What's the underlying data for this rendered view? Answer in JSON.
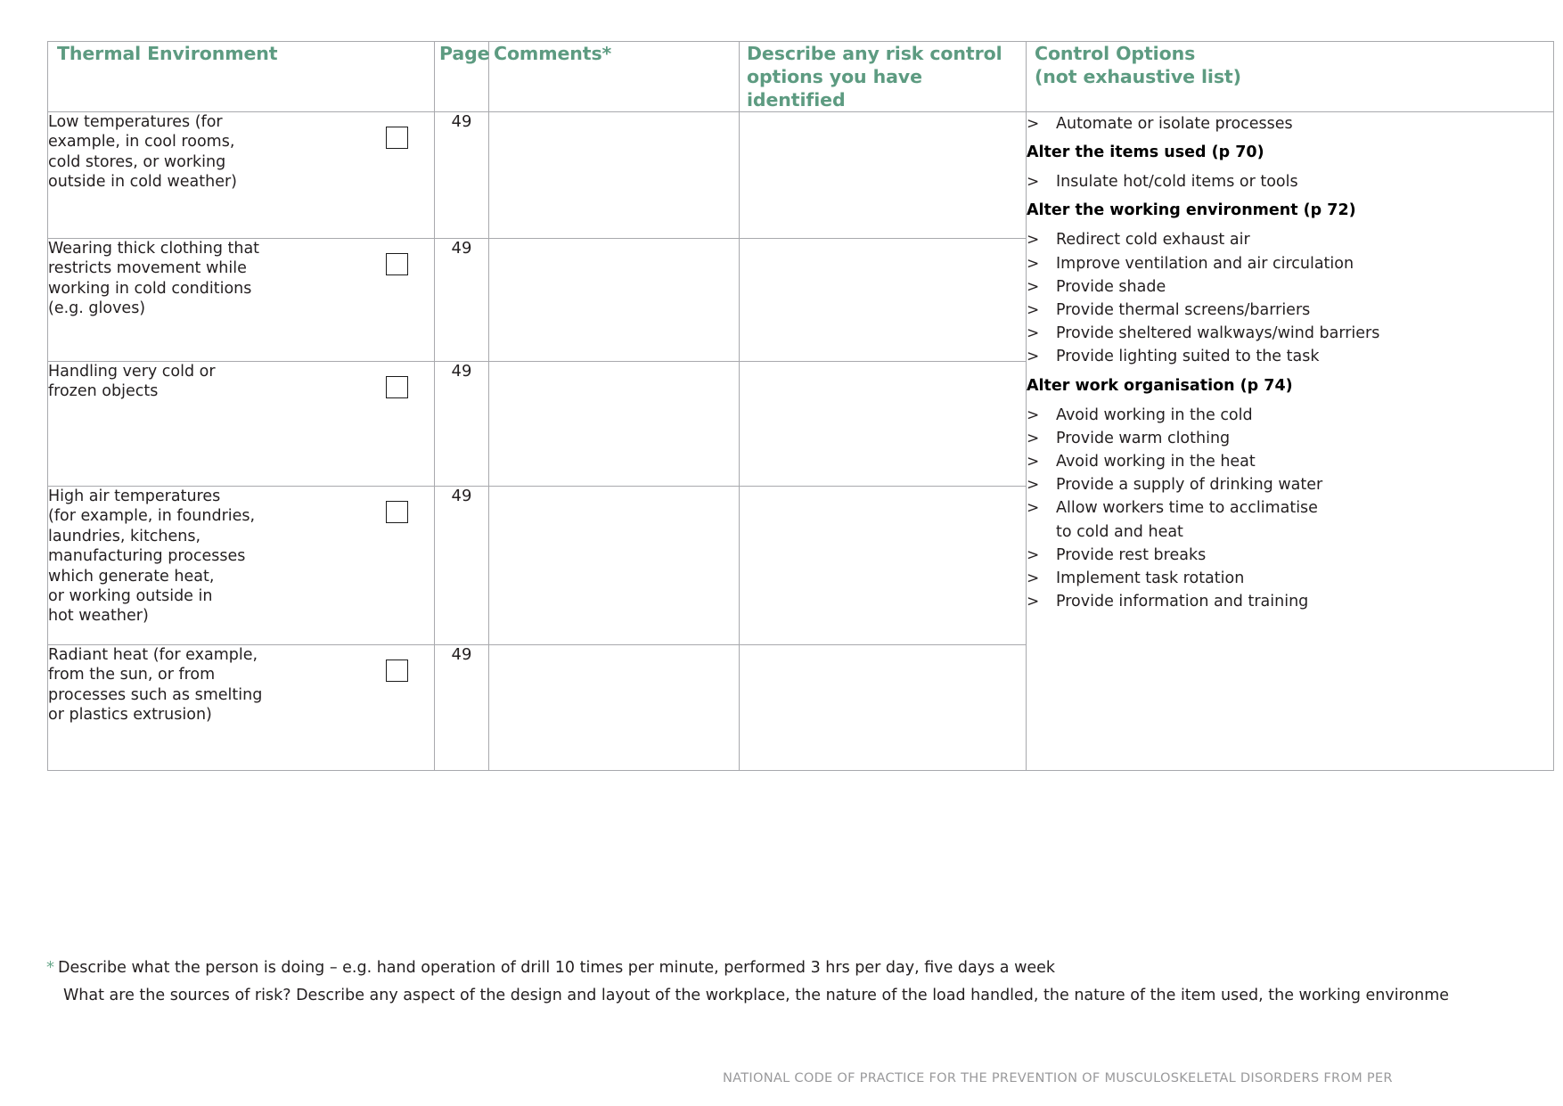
{
  "table": {
    "headers": {
      "hazard": "Thermal Environment",
      "page": "Page",
      "comments": "Comments*",
      "risk_control": "Describe any risk control\noptions you have identified",
      "control_options": "Control Options\n(not exhaustive list)"
    },
    "rows": [
      {
        "hazard": "Low temperatures (for\nexample, in cool rooms,\ncold stores, or working\noutside in cold weather)",
        "page": "49",
        "comments": "",
        "risk_control": ""
      },
      {
        "hazard": "Wearing thick clothing that\nrestricts movement while\nworking in cold conditions\n(e.g. gloves)",
        "page": "49",
        "comments": "",
        "risk_control": ""
      },
      {
        "hazard": "Handling very cold or\nfrozen objects",
        "page": "49",
        "comments": "",
        "risk_control": ""
      },
      {
        "hazard": "High air temperatures\n(for example, in foundries,\nlaundries, kitchens,\nmanufacturing processes\nwhich generate heat,\nor working outside in\nhot weather)",
        "page": "49",
        "comments": "",
        "risk_control": ""
      },
      {
        "hazard": "Radiant heat (for example,\nfrom the sun, or from\nprocesses such as smelting\nor plastics extrusion)",
        "page": "49",
        "comments": "",
        "risk_control": ""
      }
    ],
    "control_options": [
      {
        "kind": "item",
        "text": "Automate or isolate processes"
      },
      {
        "kind": "heading",
        "text": "Alter the items used (p 70)"
      },
      {
        "kind": "item",
        "text": "Insulate hot/cold items or tools"
      },
      {
        "kind": "heading",
        "text": "Alter the working environment (p 72)"
      },
      {
        "kind": "item",
        "text": "Redirect cold exhaust air"
      },
      {
        "kind": "item",
        "text": "Improve ventilation and air circulation"
      },
      {
        "kind": "item",
        "text": "Provide shade"
      },
      {
        "kind": "item",
        "text": "Provide thermal screens/barriers"
      },
      {
        "kind": "item",
        "text": "Provide sheltered walkways/wind barriers"
      },
      {
        "kind": "item",
        "text": "Provide lighting suited to the task"
      },
      {
        "kind": "heading",
        "text": "Alter work organisation (p 74)"
      },
      {
        "kind": "item",
        "text": "Avoid working in the cold"
      },
      {
        "kind": "item",
        "text": "Provide warm clothing"
      },
      {
        "kind": "item",
        "text": "Avoid working in the heat"
      },
      {
        "kind": "item",
        "text": "Provide a supply of drinking water"
      },
      {
        "kind": "item",
        "text": "Allow workers time to acclimatise\nto cold and heat"
      },
      {
        "kind": "item",
        "text": "Provide rest breaks"
      },
      {
        "kind": "item",
        "text": "Implement task rotation"
      },
      {
        "kind": "item",
        "text": "Provide information and training"
      }
    ],
    "bullet_glyph": ">"
  },
  "footnotes": {
    "marker": "*",
    "line1": "Describe what the person is doing – e.g. hand operation of drill 10 times per minute, performed 3 hrs per day, five days a week",
    "line2": "What are the sources of risk? Describe any aspect of the design and layout of the workplace, the nature of the load handled, the nature of the item used, the working environme"
  },
  "document_footer": "NATIONAL CODE OF PRACTICE FOR THE PREVENTION OF MUSCULOSKELETAL DISORDERS FROM PER",
  "colors": {
    "header_background": "#dde7e0",
    "header_text": "#5d9b81",
    "border": "#a8a9ad",
    "body_text": "#231f20",
    "footer_text": "#9a9a9c"
  }
}
